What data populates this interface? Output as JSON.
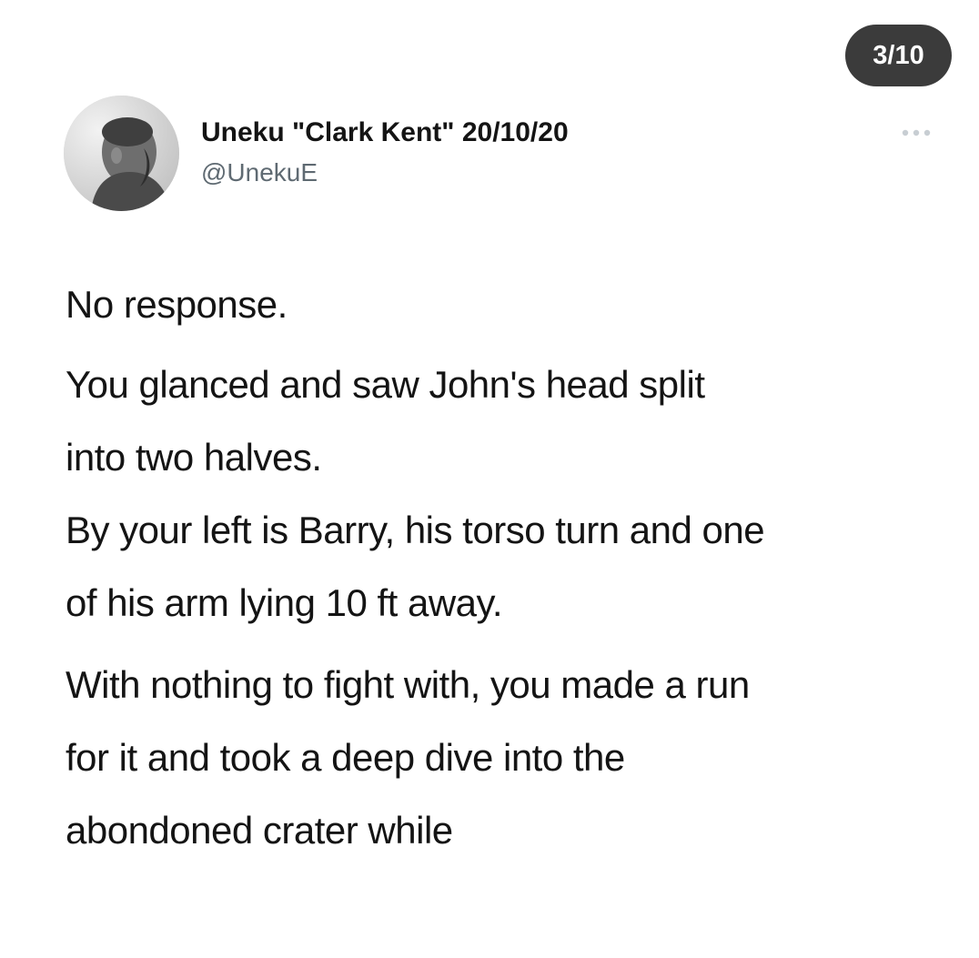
{
  "thread": {
    "counter": "3/10"
  },
  "author": {
    "display_name": "Uneku \"Clark Kent\" 20/10/20",
    "handle": "@UnekuE",
    "avatar_icon": "profile-photo"
  },
  "actions": {
    "more_icon": "ellipsis-icon"
  },
  "tweet": {
    "paragraphs": [
      "No response.",
      "You glanced and saw John's head split\ninto two halves.",
      "By your left is Barry, his torso turn and one\nof his arm lying 10 ft away.",
      "With nothing to fight with, you made a run\nfor it and took a deep dive into the\nabondoned crater while"
    ]
  }
}
